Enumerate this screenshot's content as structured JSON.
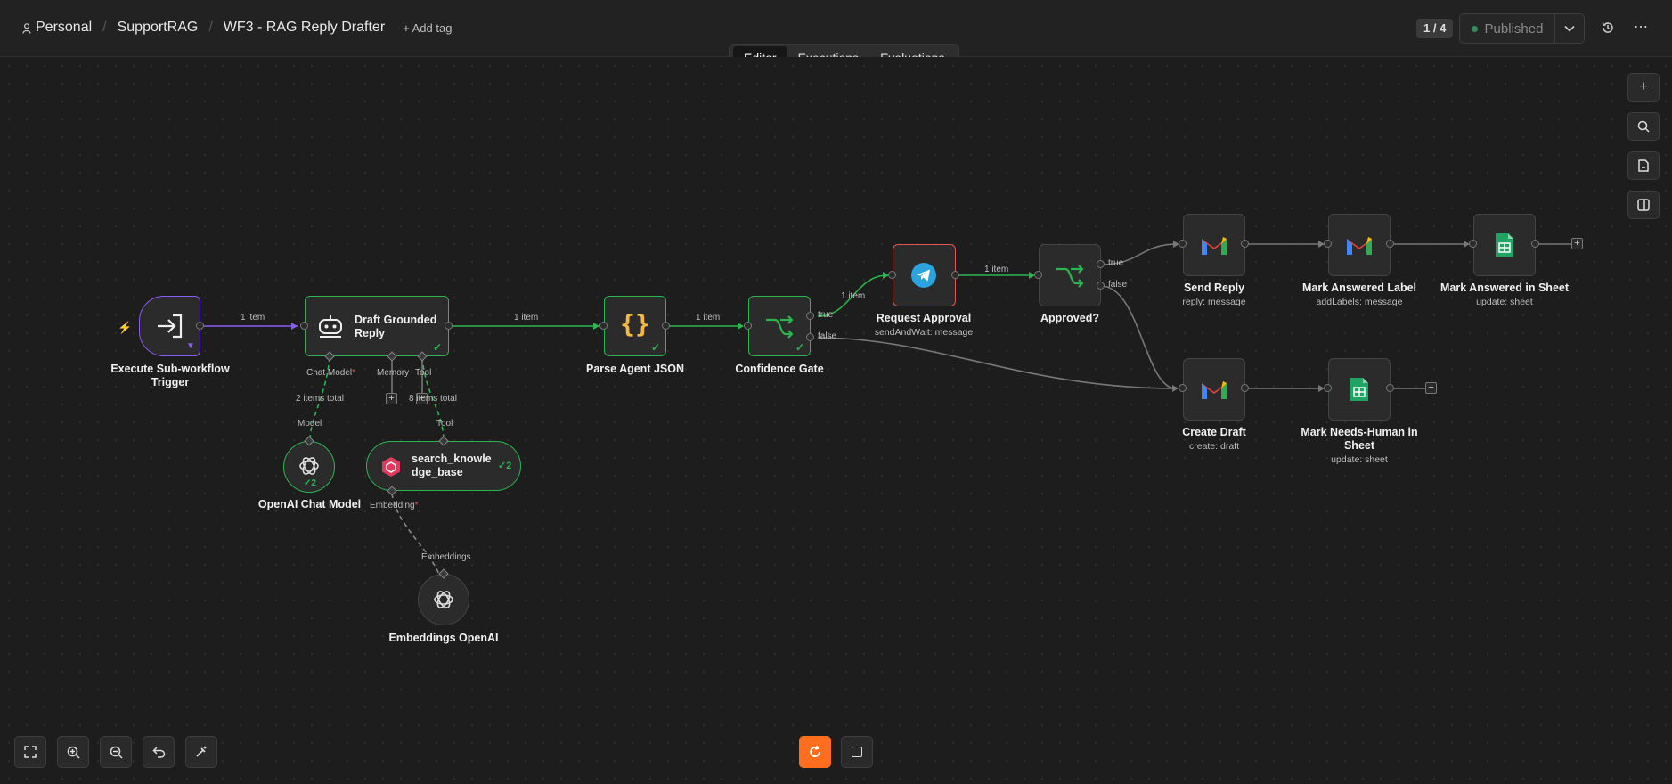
{
  "breadcrumbs": {
    "owner": "Personal",
    "project": "SupportRAG",
    "workflow": "WF3 - RAG Reply Drafter"
  },
  "add_tag": "+ Add tag",
  "version_counter": "1 / 4",
  "publish": {
    "label": "Published",
    "dropdown_icon": "chevron-down-icon"
  },
  "top_icons": [
    "history-icon",
    "more-icon"
  ],
  "tabs": [
    {
      "label": "Editor",
      "active": true
    },
    {
      "label": "Executions",
      "active": false
    },
    {
      "label": "Evaluations",
      "active": false
    }
  ],
  "right_toolbar": [
    "plus-icon",
    "search-icon",
    "sticky-note-icon",
    "panel-icon"
  ],
  "bottom_toolbar": [
    "fit-view-icon",
    "zoom-in-icon",
    "zoom-out-icon",
    "undo-icon",
    "tidy-up-icon"
  ],
  "run_controls": [
    "refresh-icon",
    "stop-icon"
  ],
  "colors": {
    "accent": "#ff6d1f",
    "success": "#2bb54e",
    "trigger": "#8b5cf6",
    "error": "#e2574c"
  },
  "nodes": {
    "trigger": {
      "title": "Execute Sub-workflow Trigger"
    },
    "draft": {
      "title": "Draft Grounded Reply",
      "ports": {
        "chat_model": "Chat Model",
        "memory": "Memory",
        "tool": "Tool"
      }
    },
    "parse": {
      "title": "Parse Agent JSON"
    },
    "gate": {
      "title": "Confidence Gate",
      "out_true": "true",
      "out_false": "false"
    },
    "approval": {
      "title": "Request Approval",
      "subtitle": "sendAndWait: message"
    },
    "approved": {
      "title": "Approved?",
      "out_true": "true",
      "out_false": "false"
    },
    "send_reply": {
      "title": "Send Reply",
      "subtitle": "reply: message"
    },
    "mark_label": {
      "title": "Mark Answered Label",
      "subtitle": "addLabels: message"
    },
    "mark_sheet": {
      "title": "Mark Answered in Sheet",
      "subtitle": "update: sheet"
    },
    "create_draft": {
      "title": "Create Draft",
      "subtitle": "create: draft"
    },
    "needs_human": {
      "title": "Mark Needs-Human in Sheet",
      "subtitle": "update: sheet"
    },
    "openai_chat": {
      "title": "OpenAI Chat Model",
      "port": "Model",
      "badge": "2"
    },
    "kb": {
      "title": "search_knowledge_base",
      "port": "Tool",
      "embedding_port": "Embedding",
      "badge": "2"
    },
    "embeddings": {
      "title": "Embeddings OpenAI",
      "port": "Embeddings"
    }
  },
  "edges": {
    "e1": "1 item",
    "e2": "1 item",
    "e3": "1 item",
    "e4": "1 item",
    "e5": "1 item",
    "chat_total": "2 items total",
    "tool_total": "8 items total"
  }
}
